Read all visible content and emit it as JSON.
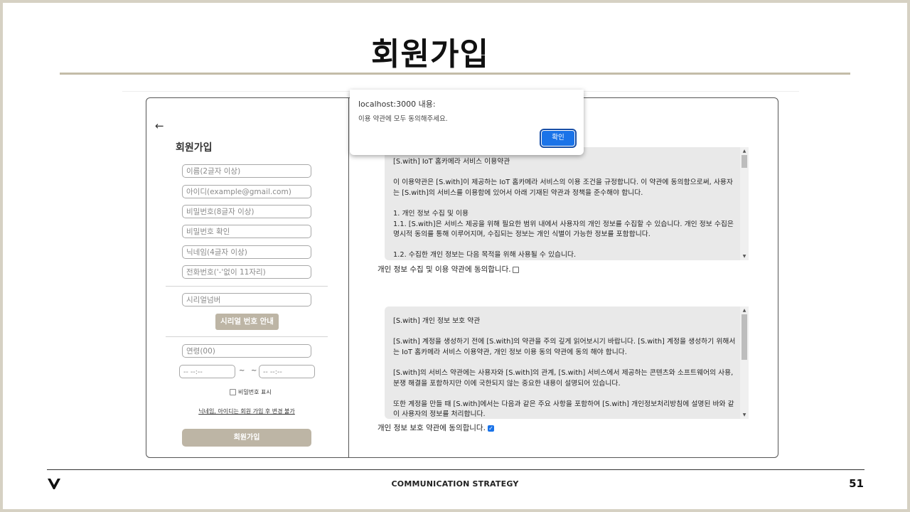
{
  "slide": {
    "title": "회원가입"
  },
  "form": {
    "back": "←",
    "title": "회원가입",
    "fields": {
      "name": "이름(2글자 이상)",
      "id": "아이디(example@gmail.com)",
      "password": "비밀번호(8글자 이상)",
      "password_confirm": "비밀번호 확인",
      "nickname": "닉네임(4글자 이상)",
      "phone": "전화번호('-'없이 11자리)",
      "serial": "시리얼넘버",
      "age": "연령(00)",
      "time_from": "-- --:--",
      "time_to": "-- --:--"
    },
    "tilde_a": "~",
    "tilde_b": "~",
    "serial_button": "시리얼 번호 안내",
    "show_password": "비밀번호 표시",
    "notice": "닉네임, 아이디는 회원 가입 후 변경 불가",
    "submit": "회원가입"
  },
  "terms": {
    "service": {
      "text": "[S.with] IoT 홈카메라 서비스 이용약관\n\n    이 이용약관은 [S.with]이 제공하는 IoT 홈카메라 서비스의 이용 조건을 규정합니다. 이 약관에 동의함으로써, 사용자는 [S.with]의 서비스를 이용함에 있어서 아래 기재된 약관과 정책을 준수해야 합니다.\n\n    1. 개인 정보 수집 및 이용\n      1.1. [S.with]은 서비스 제공을 위해 필요한 범위 내에서 사용자의 개인 정보를 수집할 수 있습니다. 개인 정보 수집은 명시적 동의를 통해 이루어지며, 수집되는 정보는 개인 식별이 가능한 정보를 포함합니다.\n\n      1.2. 수집한 개인 정보는 다음 목적을 위해 사용될 수 있습니다.",
      "agree": "개인 정보 수집 및 이용 약관에 동의합니다.",
      "checked": false
    },
    "privacy": {
      "text": "[S.with] 개인 정보 보호 약관\n\n  [S.with] 계정을 생성하기 전에 [S.with]의 약관을 주의 깊게 읽어보시기 바랍니다. [S.with] 계정을 생성하기 위해서는 IoT 홈카메라 서비스 이용약관, 개인 정보 이용 동의 약관에 동의 해야 합니다.\n\n  [S.with]의 서비스 약관에는 사용자와 [S.with]의 관계, [S.with] 서비스에서 제공하는 콘텐츠와 소프트웨어의 사용, 분쟁 해결을 포함하지만 이에 국한되지 않는 중요한 내용이 설명되어 있습니다.\n\n  또한 계정을 만들 때 [S.with]에서는 다음과 같은 주요 사항을 포함하여 [S.with] 개인정보처리방침에 설명된 바와 같이 사용자의 정보를 처리합니다.",
      "agree": "개인 정보 보호 약관에 동의합니다.",
      "checked": true
    },
    "scroll_up": "▲",
    "scroll_down": "▼"
  },
  "dialog": {
    "origin": "localhost:3000 내용:",
    "message": "이용 약관에 모두 동의해주세요.",
    "ok": "확인"
  },
  "footer": {
    "center": "COMMUNICATION STRATEGY",
    "page": "51"
  },
  "colors": {
    "accent_beige": "#bdb5a5",
    "primary_blue": "#1a73e8",
    "frame": "#d6d1c3"
  }
}
